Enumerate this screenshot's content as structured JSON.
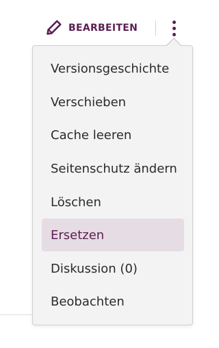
{
  "header": {
    "edit_label": "BEARBEITEN",
    "edit_icon": "pencil-icon",
    "more_icon": "kebab-menu-icon"
  },
  "colors": {
    "accent": "#5b1f52",
    "menu_background": "#f3f3f3",
    "highlight_background": "#e6dce3",
    "text": "#2a2a2a"
  },
  "menu": {
    "items": [
      {
        "label": "Versionsgeschichte"
      },
      {
        "label": "Verschieben"
      },
      {
        "label": "Cache leeren"
      },
      {
        "label": "Seitenschutz ändern"
      },
      {
        "label": "Löschen"
      },
      {
        "label": "Ersetzen",
        "highlighted": true
      },
      {
        "label": "Diskussion (0)"
      },
      {
        "label": "Beobachten"
      }
    ]
  }
}
